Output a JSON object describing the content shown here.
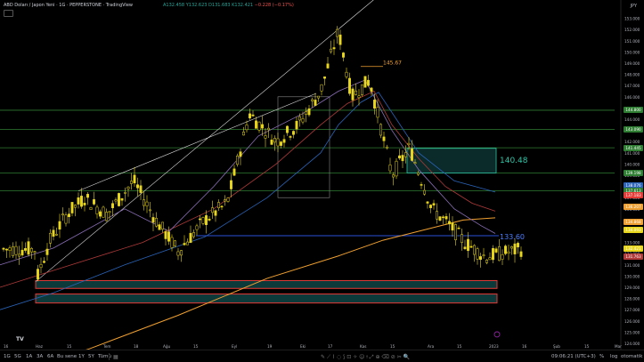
{
  "header": {
    "title": "ABD Doları / Japon Yeni · 1G · PEPPERSTONE · TradingView",
    "open": "A132.458",
    "high": "Y132.623",
    "low": "D131.683",
    "close": "K132.421",
    "change": "−0.228 (−0.17%)",
    "currency": "JPY"
  },
  "bottom_bar": {
    "timeframes": [
      "1G",
      "5G",
      "1A",
      "3A",
      "6A",
      "Bu sene",
      "1Y",
      "5Y",
      "Tümü"
    ],
    "time": "09:06:21 (UTC+3)",
    "percent": "%",
    "log": "log",
    "auto": "otomatik"
  },
  "colors": {
    "bg": "#000000",
    "candle": "#e8d61c",
    "ma_fast": "#8b6fb8",
    "ma_mid": "#b03a3a",
    "ma_slow": "#2a63b8",
    "ma_long": "#f0a030",
    "green_line": "#2e7d32",
    "blue_level": "#2c4fd9",
    "orange_level": "#f0a030"
  },
  "chart_data": {
    "type": "candlestick",
    "symbol": "USDJPY",
    "ylim": [
      124,
      154
    ],
    "x_ticks": [
      "16",
      "Haz",
      "15",
      "Tem",
      "18",
      "Ağu",
      "15",
      "Eyl",
      "19",
      "Eki",
      "17",
      "Kas",
      "15",
      "Ara",
      "15",
      "2023",
      "16",
      "Şub",
      "15",
      "Mar"
    ],
    "y_ticks": [
      "153.000",
      "152.000",
      "151.000",
      "150.000",
      "149.000",
      "148.000",
      "147.000",
      "146.000",
      "145.000",
      "144.000",
      "143.000",
      "142.000",
      "141.000",
      "140.000",
      "139.000",
      "138.000",
      "137.000",
      "136.000",
      "135.000",
      "134.000",
      "133.000",
      "132.000",
      "131.000",
      "130.000",
      "129.000",
      "128.000",
      "127.000",
      "126.000",
      "125.000",
      "124.000"
    ],
    "annotations": {
      "top_level": "145.67",
      "box_level": "140.48",
      "blue_level": "133.60"
    },
    "price_tags": [
      {
        "label": "144.800",
        "color": "#2e7d32"
      },
      {
        "label": "143.090",
        "color": "#2e7d32"
      },
      {
        "label": "141.445",
        "color": "#2e7d32"
      },
      {
        "label": "139.198",
        "color": "#2e7d32"
      },
      {
        "label": "138.076",
        "color": "#2a63b8"
      },
      {
        "label": "137.613",
        "color": "#2e7d32"
      },
      {
        "label": "137.183",
        "color": "#e53935"
      },
      {
        "label": "136.207",
        "color": "#f0a030"
      },
      {
        "label": "134.868",
        "color": "#f0a030"
      },
      {
        "label": "134.093",
        "color": "#e8d61c"
      },
      {
        "label": "132.421",
        "color": "#e8d61c"
      },
      {
        "label": "131.763",
        "color": "#b03a3a"
      }
    ]
  }
}
